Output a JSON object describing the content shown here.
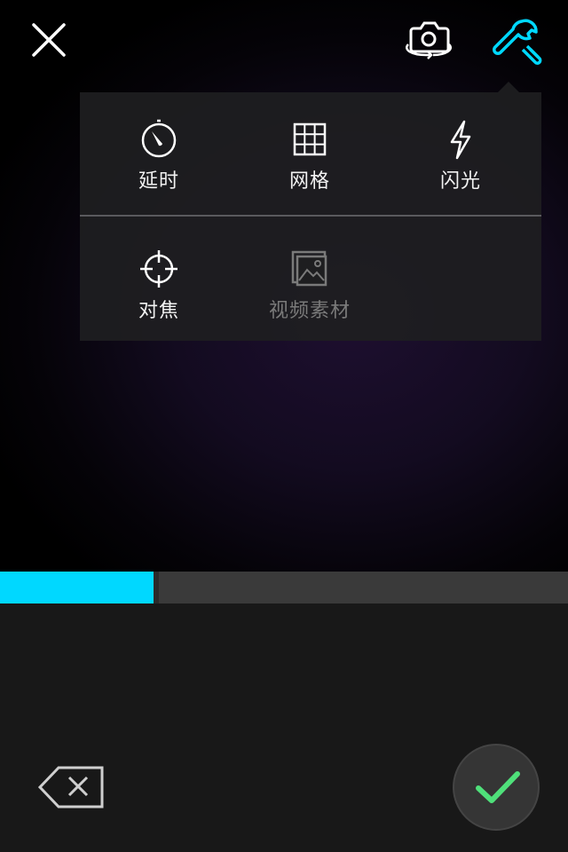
{
  "colors": {
    "accent": "#00d8ff",
    "confirm_check": "#4fe07a",
    "icon_white": "#ffffff",
    "icon_disabled": "#7a7a7a"
  },
  "top_bar": {
    "close_icon": "close-icon",
    "flip_icon": "camera-flip-icon",
    "tools_icon": "wrench-icon"
  },
  "menu": {
    "items": [
      {
        "label": "延时",
        "icon": "timer-icon",
        "enabled": true
      },
      {
        "label": "网格",
        "icon": "grid-icon",
        "enabled": true
      },
      {
        "label": "闪光",
        "icon": "flash-icon",
        "enabled": true
      },
      {
        "label": "对焦",
        "icon": "focus-icon",
        "enabled": true
      },
      {
        "label": "视频素材",
        "icon": "video-material-icon",
        "enabled": false
      }
    ]
  },
  "recording": {
    "progress_fraction": 0.27
  },
  "bottom": {
    "delete_icon": "delete-backspace-icon",
    "confirm_icon": "checkmark-icon"
  }
}
